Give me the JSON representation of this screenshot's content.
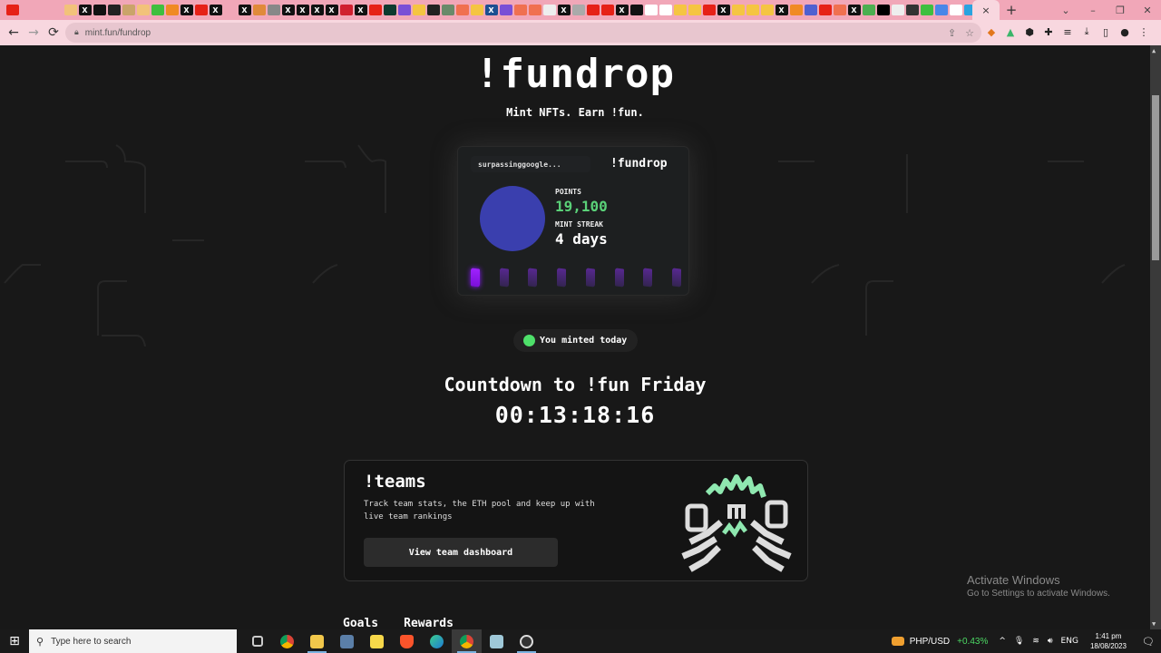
{
  "browser": {
    "tab_favicons": [
      "youtube",
      "ext",
      "sep",
      "asterisk",
      "emoji",
      "x",
      "circle-x",
      "circle-dark",
      "ant",
      "emoji",
      "green-circle",
      "orange",
      "x",
      "youtube",
      "x",
      "circle-red",
      "x",
      "orange-square",
      "globe",
      "x",
      "x",
      "x",
      "x",
      "opera",
      "x",
      "youtube",
      "dark-green",
      "list",
      "yellow",
      "medium",
      "monitor",
      "face",
      "yellow",
      "x-blue",
      "chat",
      "coin",
      "face",
      "white",
      "x",
      "grey",
      "youtube",
      "youtube",
      "x",
      "medium-dark",
      "google",
      "a",
      "yellow",
      "yellow",
      "youtube",
      "x",
      "yellow",
      "yellow",
      "yellow",
      "x",
      "orange",
      "blue-g",
      "youtube",
      "mug",
      "x",
      "green",
      "black",
      "white",
      "dark",
      "green-circle",
      "docs",
      "google",
      "telegram",
      "x",
      "youtube",
      "youtube",
      "x",
      "blue"
    ],
    "active_tab_close": "×",
    "new_tab": "+",
    "window_controls": [
      "⌄",
      "–",
      "❐",
      "✕"
    ],
    "url": "mint.fun/fundrop",
    "nav": {
      "back": "←",
      "forward": "→",
      "reload": "⟳"
    },
    "omni_actions": [
      "share-icon",
      "star-icon"
    ],
    "extensions": [
      "metamask-icon",
      "extension-green-icon",
      "extension-shield-icon",
      "puzzle-icon",
      "media-icon",
      "download-icon",
      "sidepanel-icon",
      "profile-icon",
      "menu-icon"
    ]
  },
  "page": {
    "logo": "!fundrop",
    "tagline": "Mint NFTs. Earn !fun.",
    "card": {
      "username": "surpassinggoogle...",
      "logo": "!fundrop",
      "points_label": "POINTS",
      "points_value": "19,100",
      "streak_label": "MINT STREAK",
      "streak_value": "4 days",
      "streak_days_total": 8,
      "streak_days_active": 1,
      "accent_points": "#5ad178",
      "accent_day": "#8a1aff"
    },
    "status": {
      "text": "You minted today",
      "color": "#4ee06a"
    },
    "countdown": {
      "title": "Countdown to !fun Friday",
      "value": "00:13:18:16"
    },
    "teams": {
      "title": "!teams",
      "description": "Track team stats, the ETH pool and keep up with live team rankings",
      "button": "View team dashboard"
    },
    "bottom_tabs": [
      "Goals",
      "Rewards"
    ]
  },
  "watermark": {
    "title": "Activate Windows",
    "subtitle": "Go to Settings to activate Windows."
  },
  "taskbar": {
    "search_placeholder": "Type here to search",
    "apps": [
      "task-view",
      "chrome",
      "file-explorer",
      "calculator",
      "sticky-notes",
      "brave",
      "edge",
      "chrome-profile",
      "notepad",
      "obs"
    ],
    "ticker": "PHP/USD",
    "ticker_change": "+0.43%",
    "language": "ENG",
    "time": "1:41 pm",
    "date": "18/08/2023"
  }
}
